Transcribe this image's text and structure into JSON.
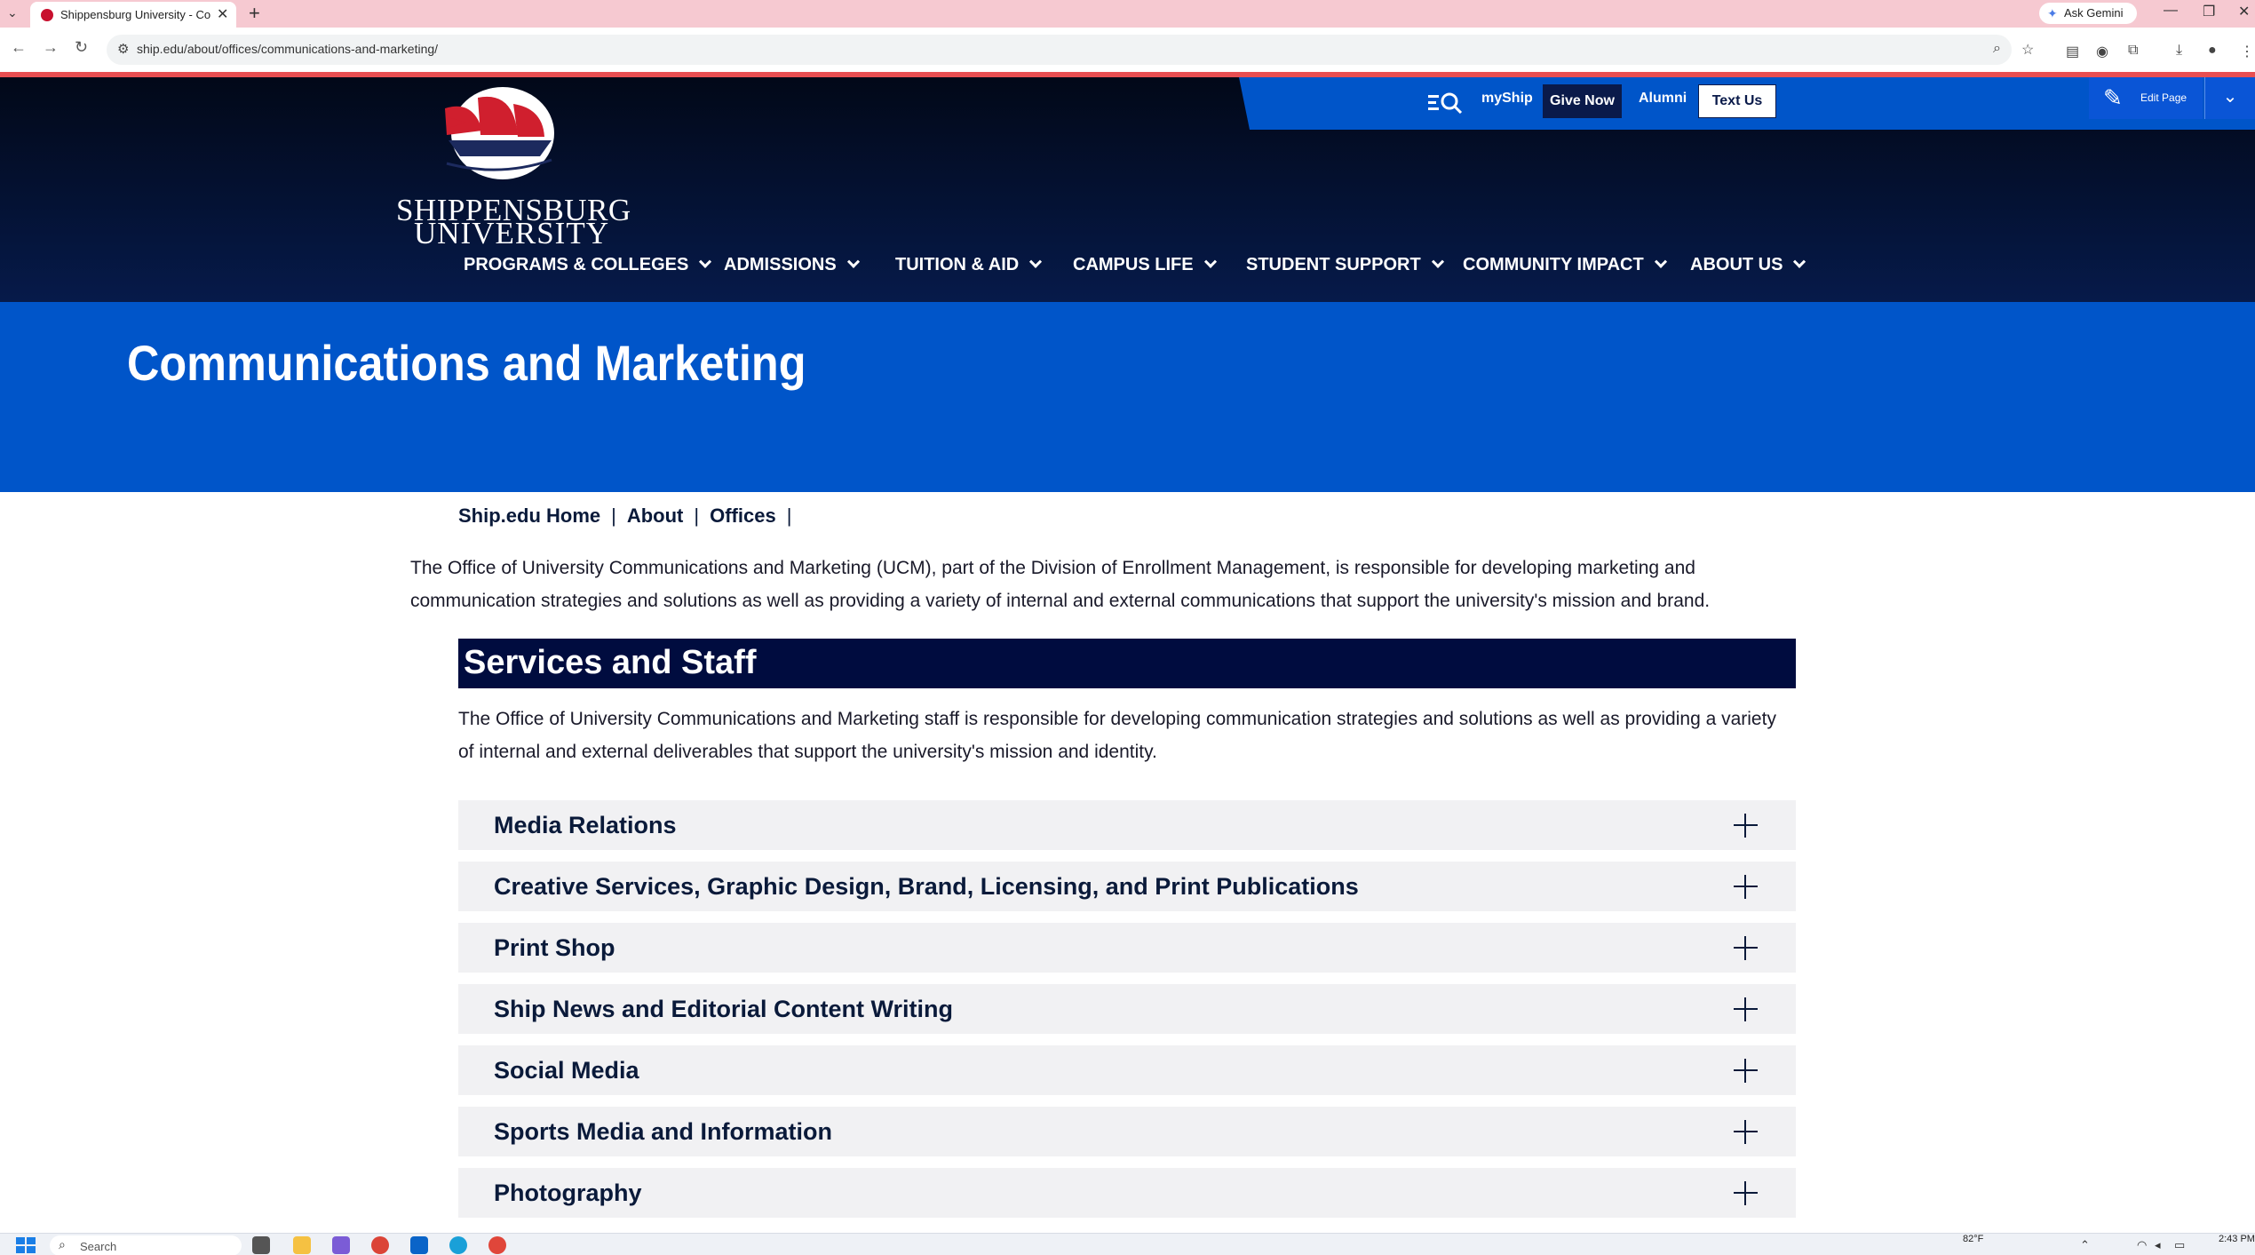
{
  "browser": {
    "tab_title": "Shippensburg University - Com",
    "close_glyph": "✕",
    "new_tab_glyph": "+",
    "ask_gemini": "Ask Gemini",
    "url": "ship.edu/about/offices/communications-and-marketing/",
    "window_controls": [
      "—",
      "❐",
      "✕"
    ]
  },
  "utility_nav": {
    "myship": "myShip",
    "give_now": "Give Now",
    "alumni": "Alumni",
    "text_us": "Text Us",
    "edit_page": "Edit Page"
  },
  "logo": {
    "line1": "SHIPPENSBURG",
    "line2": "UNIVERSITY"
  },
  "main_nav": [
    {
      "label": "PROGRAMS & COLLEGES"
    },
    {
      "label": "ADMISSIONS"
    },
    {
      "label": "TUITION & AID"
    },
    {
      "label": "CAMPUS LIFE"
    },
    {
      "label": "STUDENT SUPPORT"
    },
    {
      "label": "COMMUNITY IMPACT"
    },
    {
      "label": "ABOUT US"
    }
  ],
  "hero": {
    "title": "Communications and Marketing"
  },
  "breadcrumb": [
    {
      "label": "Ship.edu Home"
    },
    {
      "label": "About"
    },
    {
      "label": "Offices"
    }
  ],
  "breadcrumb_separator": "|",
  "intro": "The Office of University Communications and Marketing (UCM), part of the Division of Enrollment Management, is responsible for developing marketing and communication strategies and solutions as well as providing a variety of internal and external communications that support the university's mission and brand.",
  "section": {
    "title": "Services and Staff",
    "body": "The Office of University Communications and Marketing staff is responsible for developing communication strategies and solutions as well as providing a variety of internal and external deliverables that support the university's mission and identity."
  },
  "accordion": [
    {
      "label": "Media Relations"
    },
    {
      "label": "Creative Services, Graphic Design, Brand, Licensing, and Print Publications"
    },
    {
      "label": "Print Shop"
    },
    {
      "label": "Ship News and Editorial Content Writing"
    },
    {
      "label": "Social Media"
    },
    {
      "label": "Sports Media and Information"
    },
    {
      "label": "Photography"
    }
  ],
  "taskbar": {
    "search_placeholder": "Search",
    "temperature": "82°F",
    "time": "2:43 PM"
  },
  "colors": {
    "header_navy": "#061a4a",
    "brand_blue": "#0055c9",
    "section_navy": "#000c3f",
    "tab_pink": "#f6c9d1",
    "accent_red": "#e84e51"
  }
}
